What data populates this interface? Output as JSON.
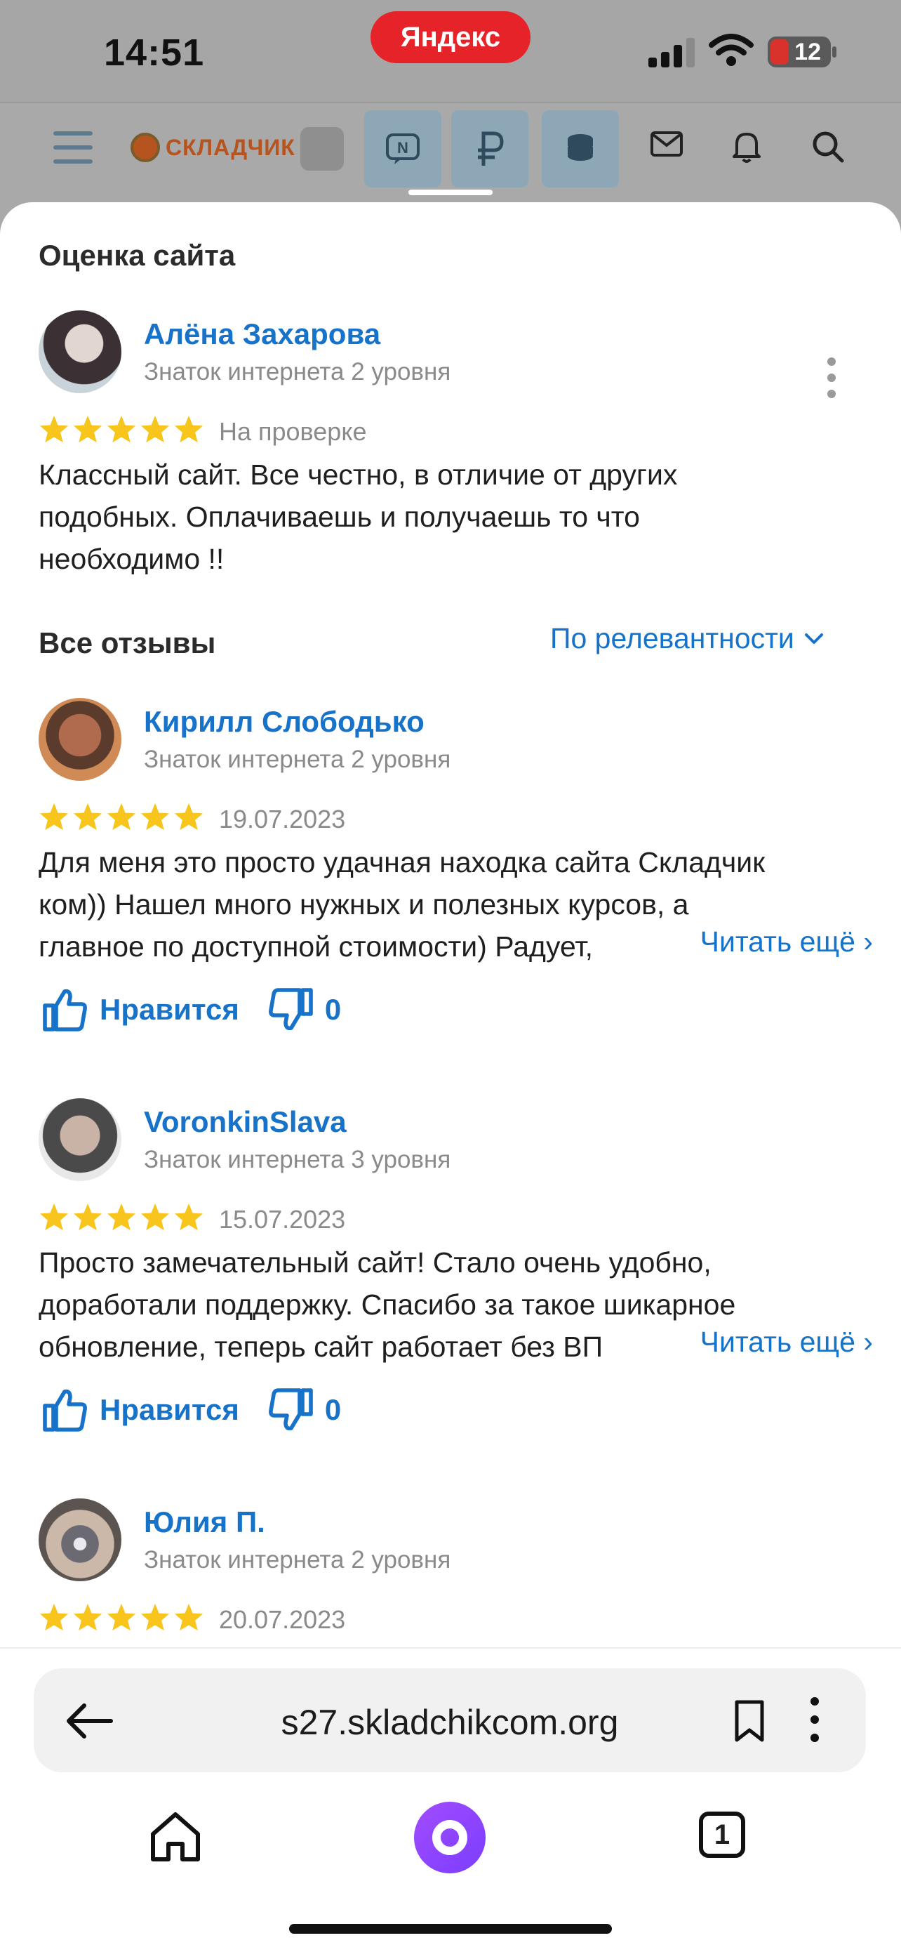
{
  "status_bar": {
    "time": "14:51",
    "browser_pill": "Яндекс",
    "battery": "12"
  },
  "site_header": {
    "logo_text": "СКЛАДЧИК"
  },
  "my_review": {
    "section_title": "Оценка сайта",
    "author": "Алёна Захарова",
    "level": "Знаток интернета 2 уровня",
    "rating": 5,
    "status": "На проверке",
    "text_lines": [
      "Классный сайт. Все честно, в отличие от других",
      "подобных. Оплачиваешь и получаешь то что",
      "необходимо !!"
    ]
  },
  "all_reviews": {
    "section_title": "Все отзывы",
    "sort_label": "По релевантности",
    "read_more": "Читать ещё",
    "like_label": "Нравится",
    "items": [
      {
        "author": "Кирилл Слободько",
        "level": "Знаток интернета 2 уровня",
        "rating": 5,
        "date": "19.07.2023",
        "text_lines": [
          "Для меня это просто удачная находка сайта Складчик",
          "ком)) Нашел много нужных и полезных курсов, а",
          "главное по доступной стоимости) Радует,"
        ],
        "dislikes": "0"
      },
      {
        "author": "VoronkinSlava",
        "level": "Знаток интернета 3 уровня",
        "rating": 5,
        "date": "15.07.2023",
        "text_lines": [
          "Просто замечательный сайт! Стало очень удобно,",
          "доработали поддержку. Спасибо за такое шикарное",
          "обновление, теперь сайт работает без ВП"
        ],
        "dislikes": "0"
      },
      {
        "author": "Юлия П.",
        "level": "Знаток интернета 2 уровня",
        "rating": 5,
        "date": "20.07.2023"
      }
    ]
  },
  "bottom_bar": {
    "url": "s27.skladchikcom.org",
    "tabs_count": "1"
  },
  "colors": {
    "accent": "#1673c9",
    "star": "#f7c51c",
    "alice": "#8b45ff",
    "pill": "#e7232a"
  }
}
